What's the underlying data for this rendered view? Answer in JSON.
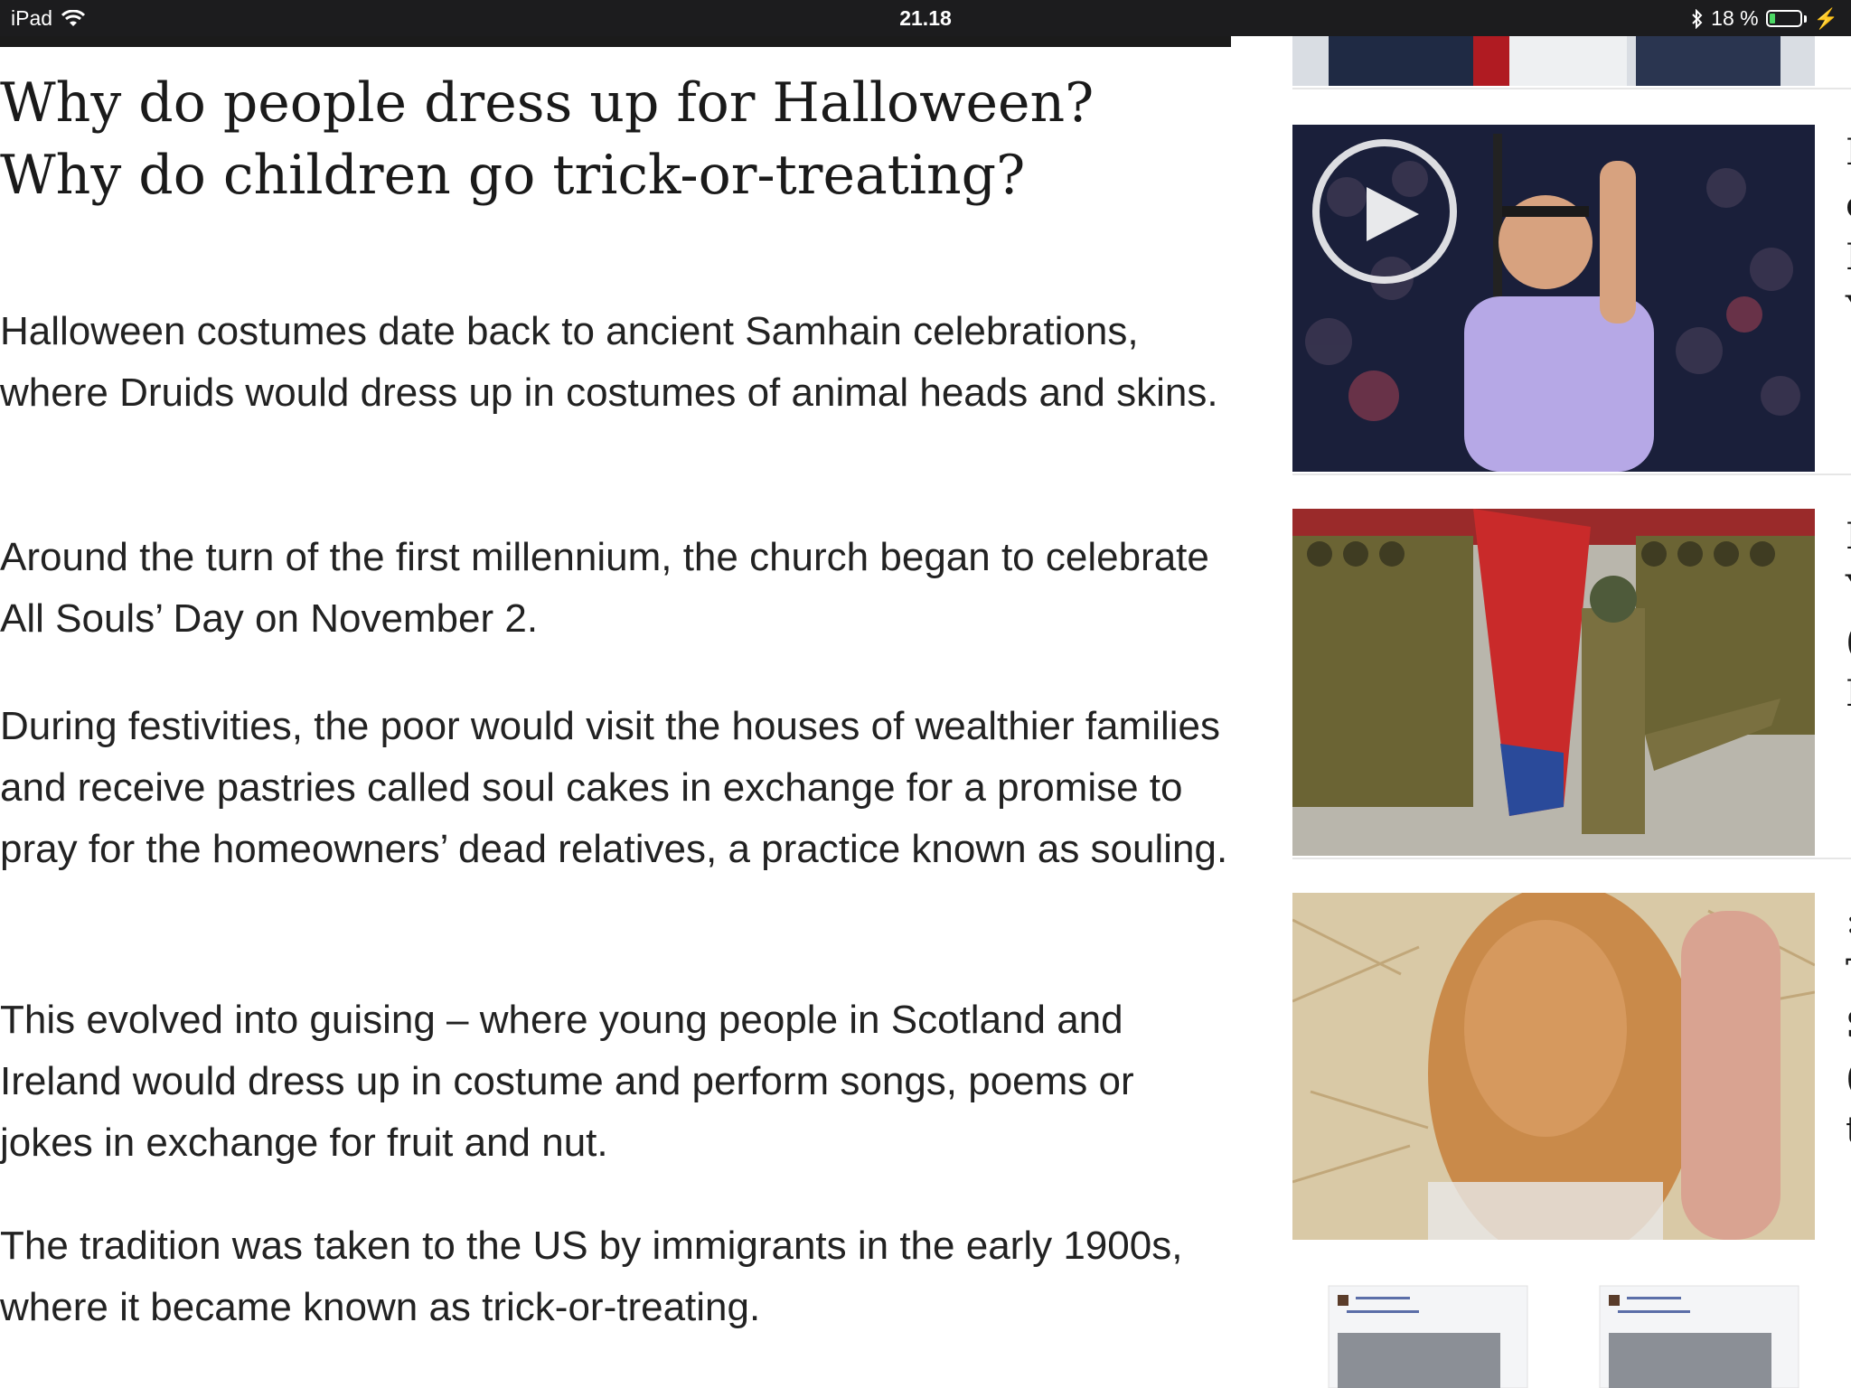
{
  "status_bar": {
    "device": "iPad",
    "time": "21.18",
    "battery_text": "18 %",
    "battery_level": 0.18,
    "icons": [
      "wifi-icon",
      "bluetooth-icon",
      "battery-icon",
      "charging-icon"
    ]
  },
  "article": {
    "headline": "Why do people dress up for Halloween? Why do children go trick-or-treating?",
    "paragraphs": [
      "Halloween costumes date back to ancient Samhain celebrations, where Druids would dress up in costumes of animal heads and skins.",
      "Around the turn of the first millennium, the church began to celebrate All Souls’ Day on November 2.",
      "During festivities, the poor would visit the houses of wealthier families and receive pastries called soul cakes in exchange for a promise to pray for the homeowners’ dead relatives, a practice known as souling.",
      "This evolved into guising – where young people in Scotland and Ireland would dress up in costume and perform songs, poems or jokes in exchange for fruit and nut.",
      "The tradition was taken to the US by immigrants in the early 1900s, where it became known as trick-or-treating."
    ]
  },
  "sidebar": {
    "thumbnails": [
      {
        "subject": "suited figures (cropped)"
      },
      {
        "subject": "tennis player waving with racket",
        "has_video": true
      },
      {
        "subject": "soldiers marching with red flag"
      },
      {
        "subject": "potato held in hand"
      },
      {
        "subject": "social media screenshot collage"
      }
    ]
  },
  "colors": {
    "status_bar_bg": "#1c1c1e",
    "battery_fill": "#4cd964",
    "accent_red": "#c8102e",
    "text": "#222222"
  }
}
